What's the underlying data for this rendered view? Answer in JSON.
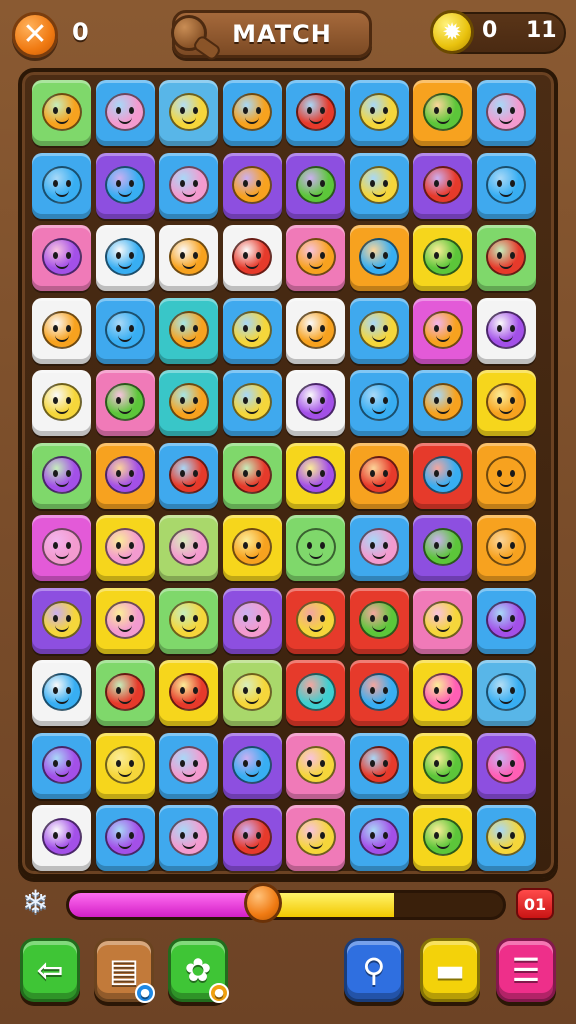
{
  "header": {
    "close_icon": "close-x-icon",
    "left_count": "0",
    "title": "MATCH",
    "score": "0",
    "target": "11",
    "star_icon": "star-badge-icon"
  },
  "progress": {
    "icon": "snowflake-icon",
    "magenta_fraction": 0.47,
    "yellow_fraction": 0.28,
    "level_label": "01"
  },
  "toolbar": {
    "buttons": [
      {
        "name": "back-arrow-button",
        "icon": "back-arrow-icon",
        "glyph": "⇦",
        "color": "#3fc536"
      },
      {
        "name": "card-machine-button",
        "icon": "card-machine-icon",
        "glyph": "▤",
        "color": "#c27a3a",
        "badge": "●",
        "badge_color": "#1e88e5"
      },
      {
        "name": "gear-tile-button",
        "icon": "gear-icon",
        "glyph": "✿",
        "color": "#3fc536",
        "badge": "●",
        "badge_color": "#f0a010"
      },
      {
        "name": "magnifier-button",
        "icon": "magnifier-icon",
        "glyph": "⚲",
        "color": "#2f6fe0"
      },
      {
        "name": "tools-button",
        "icon": "tools-icon",
        "glyph": "▬",
        "color": "#f3d20a"
      },
      {
        "name": "menu-button",
        "icon": "menu-icon",
        "glyph": "☰",
        "color": "#ee2f8a"
      }
    ]
  },
  "palette": {
    "g": "#7fd86b",
    "b": "#3fa9ee",
    "bl": "#58b6e8",
    "o": "#f7a21f",
    "y": "#f6d61c",
    "p": "#8d4fe0",
    "pk": "#f07ab8",
    "w": "#f4f4f4",
    "r": "#e63a2b",
    "tl": "#39c6c8",
    "mg": "#e35ad8",
    "lg": "#a9d86b"
  },
  "creature_colors": {
    "o": "#f7a21f",
    "pk": "#f39bcf",
    "y": "#f5d63b",
    "r": "#e63a2b",
    "b": "#38aef2",
    "g": "#5cc63a",
    "p": "#a350e8",
    "tl": "#3fcfd0",
    "mg": "#ff5fb5"
  },
  "board": {
    "tiles": [
      [
        "g:o",
        "b:pk",
        "bl:y",
        "b:o",
        "b:r",
        "b:y",
        "o:g",
        "b:pk"
      ],
      [
        "b:b",
        "p:b",
        "b:pk",
        "p:o",
        "p:g",
        "b:y",
        "p:r",
        "b:b"
      ],
      [
        "pk:p",
        "w:b",
        "w:o",
        "w:r",
        "pk:o",
        "o:b",
        "y:g",
        "g:r"
      ],
      [
        "w:o",
        "b:b",
        "tl:o",
        "b:y",
        "w:o",
        "b:y",
        "mg:o",
        "w:p"
      ],
      [
        "w:y",
        "pk:g",
        "tl:o",
        "b:y",
        "w:p",
        "b:b",
        "b:o",
        "y:o"
      ],
      [
        "g:p",
        "o:p",
        "b:r",
        "g:r",
        "y:p",
        "o:r",
        "r:b",
        "o:w"
      ],
      [
        "mg:pk",
        "y:pk",
        "lg:pk",
        "y:o",
        "g:w",
        "b:pk",
        "p:g",
        "o:o"
      ],
      [
        "p:y",
        "y:pk",
        "g:y",
        "p:pk",
        "r:y",
        "r:g",
        "pk:y",
        "b:p"
      ],
      [
        "w:b",
        "g:r",
        "y:r",
        "lg:y",
        "r:tl",
        "r:b",
        "y:mg",
        "bl:b"
      ],
      [
        "b:p",
        "y:y",
        "b:pk",
        "p:b",
        "pk:y",
        "b:r",
        "y:g",
        "p:mg"
      ],
      [
        "w:p",
        "b:p",
        "b:pk",
        "p:r",
        "pk:y",
        "b:p",
        "y:g",
        "b:y"
      ]
    ]
  }
}
